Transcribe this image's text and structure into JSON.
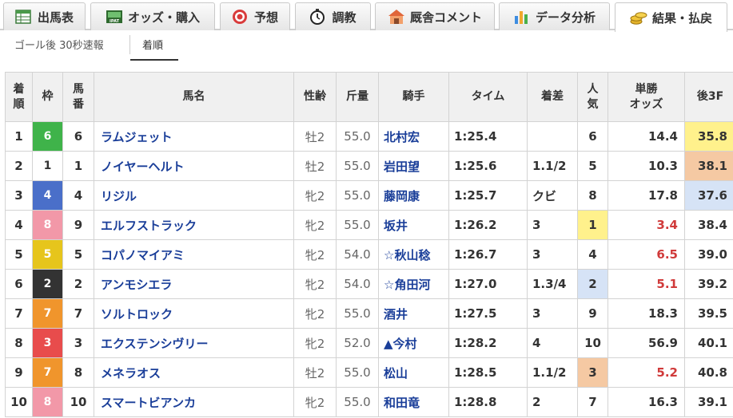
{
  "tabs": [
    {
      "label": "出馬表",
      "icon": "table-icon"
    },
    {
      "label": "オッズ・購入",
      "icon": "ipat-icon"
    },
    {
      "label": "予想",
      "icon": "target-icon"
    },
    {
      "label": "調教",
      "icon": "stopwatch-icon"
    },
    {
      "label": "厩舎コメント",
      "icon": "stable-icon"
    },
    {
      "label": "データ分析",
      "icon": "bar-chart-icon"
    },
    {
      "label": "結果・払戻",
      "icon": "coins-icon"
    }
  ],
  "active_tab": "結果・払戻",
  "subtabs": {
    "flash": "ゴール後 30秒速報",
    "order": "着順"
  },
  "columns": {
    "rank": [
      "着",
      "順"
    ],
    "waku": "枠",
    "num": [
      "馬",
      "番"
    ],
    "name": "馬名",
    "sexage": "性齢",
    "weight": "斤量",
    "jockey": "騎手",
    "time": "タイム",
    "margin": "着差",
    "pop": [
      "人",
      "気"
    ],
    "odds": [
      "単勝",
      "オッズ"
    ],
    "f3": "後3F"
  },
  "waku_colors": {
    "1": {
      "bg": "#ffffff",
      "fg": "#333333"
    },
    "2": {
      "bg": "#333333",
      "fg": "#ffffff"
    },
    "3": {
      "bg": "#e84c4c",
      "fg": "#ffffff"
    },
    "4": {
      "bg": "#4a6fc9",
      "fg": "#ffffff"
    },
    "5": {
      "bg": "#e6c51c",
      "fg": "#ffffff"
    },
    "6": {
      "bg": "#3fb34a",
      "fg": "#ffffff"
    },
    "7": {
      "bg": "#f0952c",
      "fg": "#ffffff"
    },
    "8": {
      "bg": "#f298a8",
      "fg": "#ffffff"
    }
  },
  "highlight_colors": {
    "gold": "#fff18c",
    "silver": "#d6e3f6",
    "bronze": "#f5c9a3",
    "odds_red": "#d03a3a",
    "horse_link": "#1a3e99"
  },
  "rows": [
    {
      "rank": "1",
      "waku": "6",
      "num": "6",
      "name": "ラムジェット",
      "sexage": "牡2",
      "weight": "55.0",
      "jockey": "北村宏",
      "time": "1:25.4",
      "margin": "",
      "pop": "6",
      "odds": "14.4",
      "f3": "35.8",
      "f3_hl": "gold",
      "pop_hl": "",
      "odds_red": false
    },
    {
      "rank": "2",
      "waku": "1",
      "num": "1",
      "name": "ノイヤーヘルト",
      "sexage": "牡2",
      "weight": "55.0",
      "jockey": "岩田望",
      "time": "1:25.6",
      "margin": "1.1/2",
      "pop": "5",
      "odds": "10.3",
      "f3": "38.1",
      "f3_hl": "bronze",
      "pop_hl": "",
      "odds_red": false
    },
    {
      "rank": "3",
      "waku": "4",
      "num": "4",
      "name": "リジル",
      "sexage": "牝2",
      "weight": "55.0",
      "jockey": "藤岡康",
      "time": "1:25.7",
      "margin": "クビ",
      "pop": "8",
      "odds": "17.8",
      "f3": "37.6",
      "f3_hl": "silver",
      "pop_hl": "",
      "odds_red": false
    },
    {
      "rank": "4",
      "waku": "8",
      "num": "9",
      "name": "エルフストラック",
      "sexage": "牝2",
      "weight": "55.0",
      "jockey": "坂井",
      "time": "1:26.2",
      "margin": "3",
      "pop": "1",
      "odds": "3.4",
      "f3": "38.4",
      "f3_hl": "",
      "pop_hl": "gold",
      "odds_red": true
    },
    {
      "rank": "5",
      "waku": "5",
      "num": "5",
      "name": "コパノマイアミ",
      "sexage": "牝2",
      "weight": "54.0",
      "jockey": "☆秋山稔",
      "time": "1:26.7",
      "margin": "3",
      "pop": "4",
      "odds": "6.5",
      "f3": "39.0",
      "f3_hl": "",
      "pop_hl": "",
      "odds_red": true
    },
    {
      "rank": "6",
      "waku": "2",
      "num": "2",
      "name": "アンモシエラ",
      "sexage": "牝2",
      "weight": "54.0",
      "jockey": "☆角田河",
      "time": "1:27.0",
      "margin": "1.3/4",
      "pop": "2",
      "odds": "5.1",
      "f3": "39.2",
      "f3_hl": "",
      "pop_hl": "silver",
      "odds_red": true
    },
    {
      "rank": "7",
      "waku": "7",
      "num": "7",
      "name": "ソルトロック",
      "sexage": "牝2",
      "weight": "55.0",
      "jockey": "酒井",
      "time": "1:27.5",
      "margin": "3",
      "pop": "9",
      "odds": "18.3",
      "f3": "39.5",
      "f3_hl": "",
      "pop_hl": "",
      "odds_red": false
    },
    {
      "rank": "8",
      "waku": "3",
      "num": "3",
      "name": "エクステンシヴリー",
      "sexage": "牝2",
      "weight": "52.0",
      "jockey": "▲今村",
      "time": "1:28.2",
      "margin": "4",
      "pop": "10",
      "odds": "56.9",
      "f3": "40.1",
      "f3_hl": "",
      "pop_hl": "",
      "odds_red": false
    },
    {
      "rank": "9",
      "waku": "7",
      "num": "8",
      "name": "メネラオス",
      "sexage": "牡2",
      "weight": "55.0",
      "jockey": "松山",
      "time": "1:28.5",
      "margin": "1.1/2",
      "pop": "3",
      "odds": "5.2",
      "f3": "40.8",
      "f3_hl": "",
      "pop_hl": "bronze",
      "odds_red": true
    },
    {
      "rank": "10",
      "waku": "8",
      "num": "10",
      "name": "スマートビアンカ",
      "sexage": "牝2",
      "weight": "55.0",
      "jockey": "和田竜",
      "time": "1:28.8",
      "margin": "2",
      "pop": "7",
      "odds": "16.3",
      "f3": "39.1",
      "f3_hl": "",
      "pop_hl": "",
      "odds_red": false
    }
  ]
}
